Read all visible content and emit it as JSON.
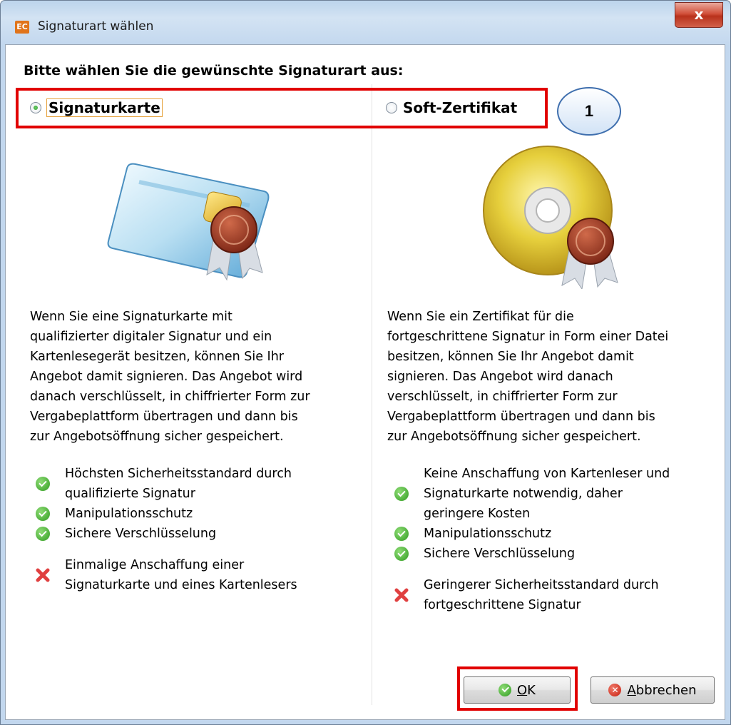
{
  "window": {
    "title": "Signaturart wählen",
    "app_icon_text": "EC",
    "close_glyph": "x"
  },
  "dialog": {
    "heading": "Bitte wählen Sie die gewünschte Signaturart aus:",
    "callout_number": "1",
    "options": [
      {
        "label": "Signaturkarte",
        "selected": true,
        "illustration_icon": "smartcard-certificate-icon",
        "description": "Wenn Sie eine Signaturkarte mit\nqualifizierter digitaler Signatur und ein\nKartenlesegerät besitzen, können Sie Ihr\nAngebot damit signieren. Das Angebot wird\ndanach verschlüsselt, in chiffrierter Form zur\nVergabeplattform übertragen und dann bis\nzur Angebotsöffnung sicher gespeichert.",
        "pros": [
          "Höchsten Sicherheitsstandard durch\nqualifizierte Signatur",
          "Manipulationsschutz",
          "Sichere Verschlüsselung"
        ],
        "cons": [
          "Einmalige Anschaffung einer\nSignaturkarte und eines Kartenlesers"
        ]
      },
      {
        "label": "Soft-Zertifikat",
        "selected": false,
        "illustration_icon": "cd-certificate-icon",
        "description": "Wenn Sie ein Zertifikat für die\nfortgeschrittene Signatur in Form einer Datei\nbesitzen, können Sie Ihr Angebot damit\nsignieren. Das Angebot wird danach\nverschlüsselt, in chiffrierter Form zur\nVergabeplattform übertragen und dann bis\nzur Angebotsöffnung sicher gespeichert.",
        "pros": [
          "Keine Anschaffung von Kartenleser und\nSignaturkarte notwendig, daher\ngeringere Kosten",
          "Manipulationsschutz",
          "Sichere Verschlüsselung"
        ],
        "cons": [
          "Geringerer Sicherheitsstandard durch\nfortgeschrittene Signatur"
        ]
      }
    ]
  },
  "buttons": {
    "ok_mnemonic": "O",
    "ok_rest": "K",
    "cancel_mnemonic": "A",
    "cancel_rest": "bbrechen"
  },
  "colors": {
    "highlight_box": "#e10000",
    "check_green": "#4caf3a",
    "cross_red": "#e04040"
  }
}
